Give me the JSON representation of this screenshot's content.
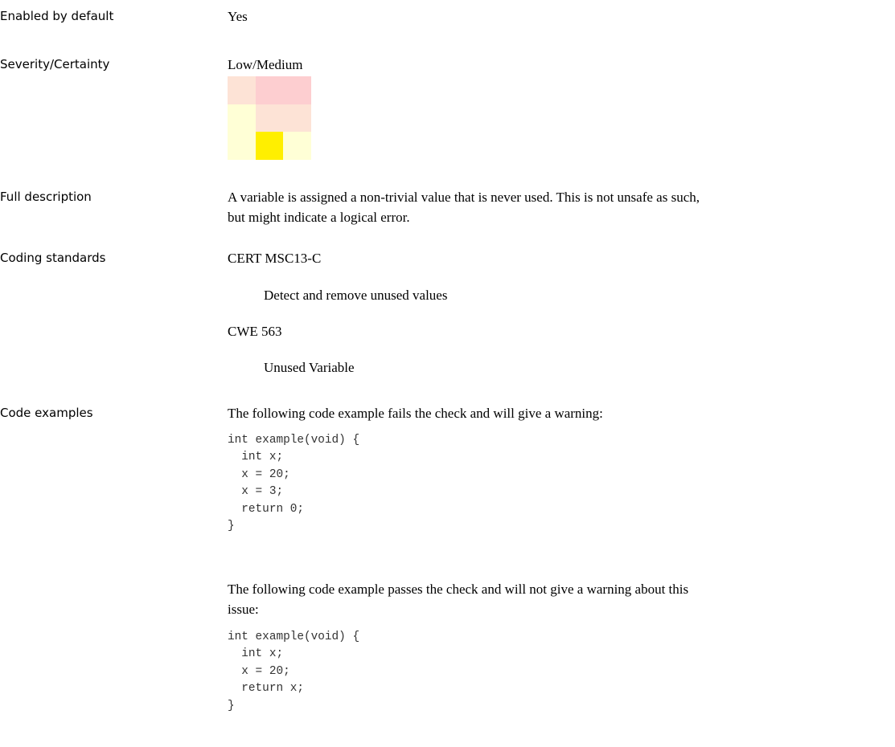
{
  "rows": {
    "enabled": {
      "label": "Enabled by default",
      "value": "Yes"
    },
    "severity": {
      "label": "Severity/Certainty",
      "value": "Low/Medium",
      "matrix_colors": [
        [
          "#fde3d6",
          "#fdced0",
          "#fdced0"
        ],
        [
          "#ffffd6",
          "#fde3d6",
          "#fde3d6"
        ],
        [
          "#ffffd6",
          "#ffef00",
          "#ffffd6"
        ]
      ]
    },
    "description": {
      "label": "Full description",
      "line1": "A variable is assigned a non-trivial value that is never used.  This is not unsafe as such,",
      "line2": "but might indicate a logical error."
    },
    "coding": {
      "label": "Coding standards",
      "standards": [
        {
          "name": "CERT MSC13-C",
          "desc": "Detect and remove unused values"
        },
        {
          "name": "CWE 563",
          "desc": "Unused Variable"
        }
      ]
    },
    "examples": {
      "label": "Code examples",
      "fail_intro": "The following code example fails the check and will give a warning:",
      "fail_code": "int example(void) {\n  int x;\n  x = 20;\n  x = 3;\n  return 0;\n}",
      "pass_intro_line1": "The following code example passes the check and will not give a warning about this",
      "pass_intro_line2": "issue:",
      "pass_code": "int example(void) {\n  int x;\n  x = 20;\n  return x;\n}"
    }
  }
}
